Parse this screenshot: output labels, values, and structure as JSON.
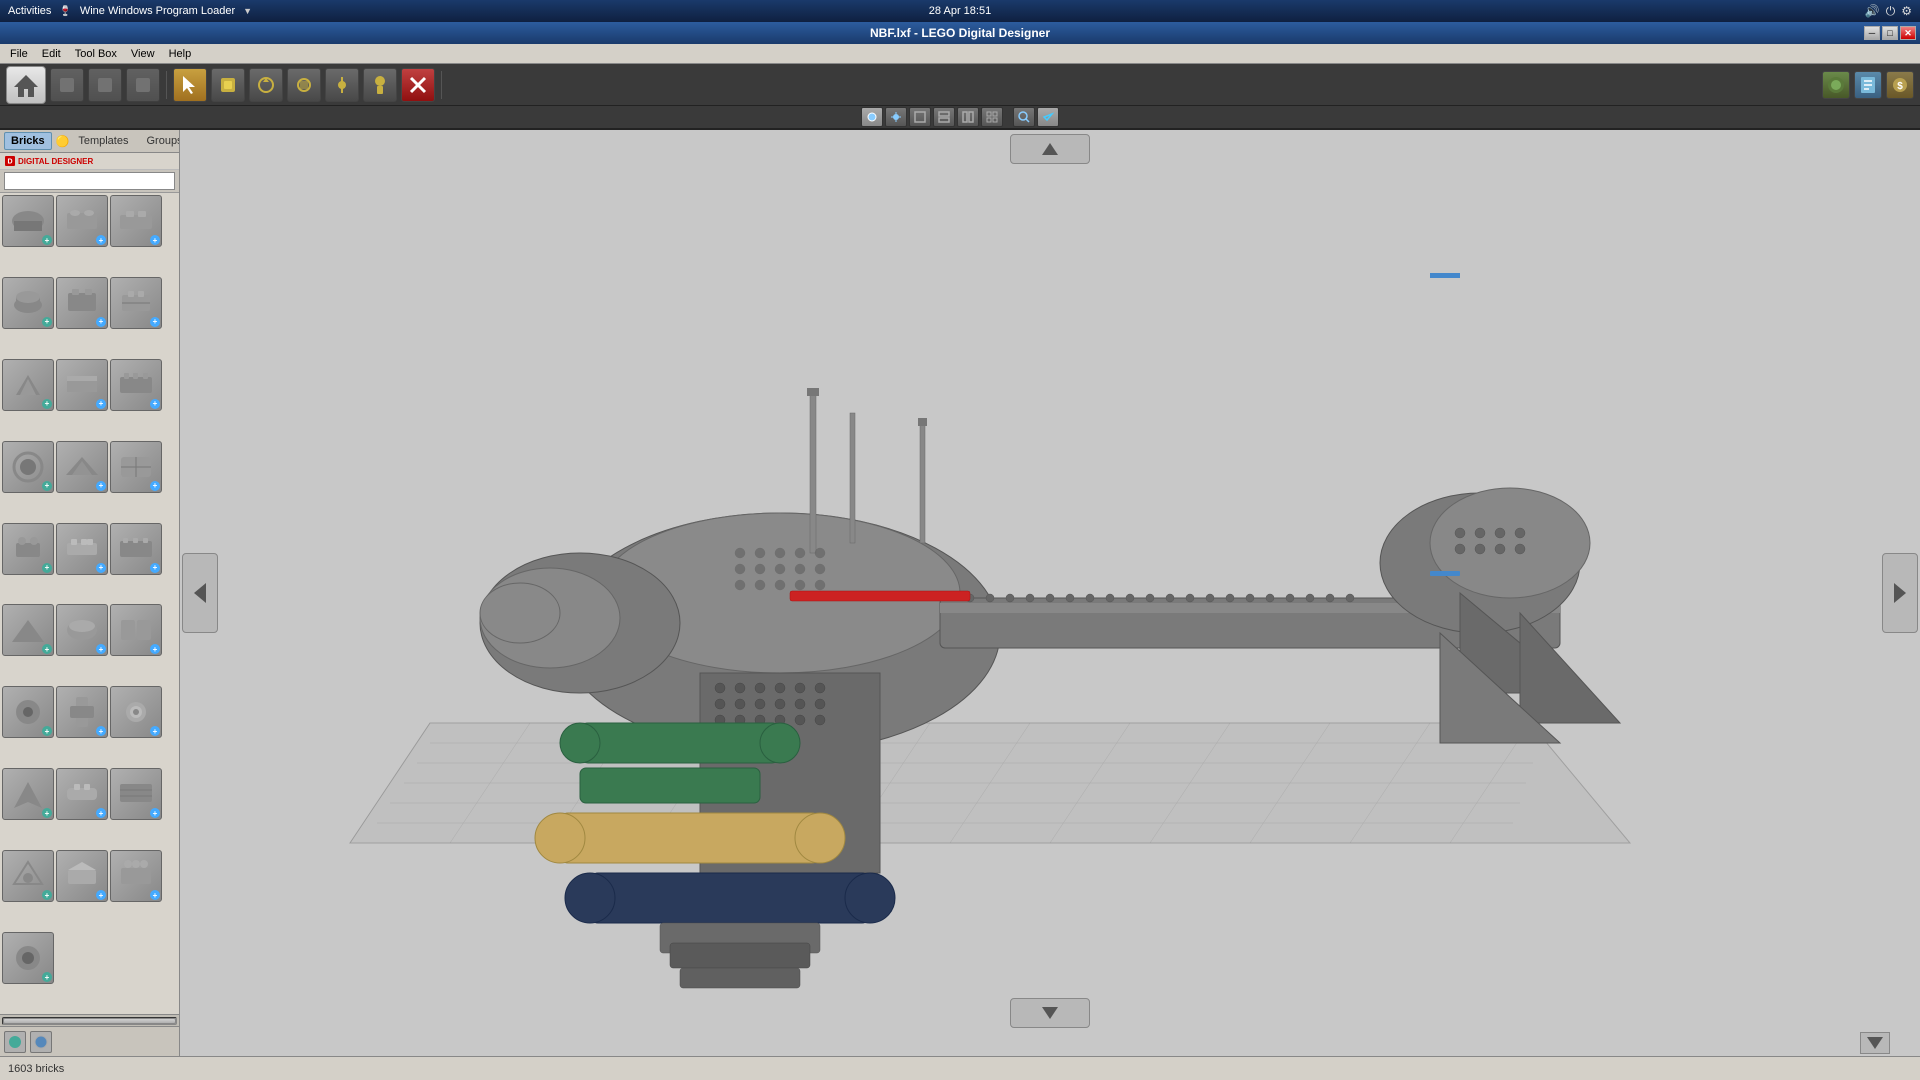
{
  "system": {
    "activities_label": "Activities",
    "wine_label": "Wine Windows Program Loader",
    "datetime": "28 Apr  18:51"
  },
  "window": {
    "title": "NBF.lxf - LEGO Digital Designer",
    "close_symbol": "✕",
    "minimize_symbol": "─",
    "maximize_symbol": "□"
  },
  "menu": {
    "items": [
      "File",
      "Edit",
      "Tool Box",
      "View",
      "Help"
    ]
  },
  "toolbar": {
    "home_icon": "🏠",
    "tools": [
      {
        "name": "select",
        "icon": "↖",
        "active": true
      },
      {
        "name": "move",
        "icon": "✋"
      },
      {
        "name": "rotate3d",
        "icon": "⟳"
      },
      {
        "name": "multirotate",
        "icon": "⟲"
      },
      {
        "name": "hinge",
        "icon": "🔧"
      },
      {
        "name": "paint",
        "icon": "🎨"
      },
      {
        "name": "delete",
        "icon": "✕",
        "accent": true
      }
    ]
  },
  "toolbar2": {
    "tools": [
      {
        "name": "snap",
        "icon": "◼",
        "active": true
      },
      {
        "name": "grid",
        "icon": "⊞"
      },
      {
        "name": "view1",
        "icon": "◱"
      },
      {
        "name": "view2",
        "icon": "◰"
      },
      {
        "name": "view3",
        "icon": "◳"
      },
      {
        "name": "view4",
        "icon": "◲"
      },
      {
        "name": "zoomin",
        "icon": "⊕",
        "active": true
      }
    ]
  },
  "panel": {
    "tabs": [
      {
        "label": "Bricks",
        "active": true
      },
      {
        "label": "Templates"
      },
      {
        "label": "Groups"
      }
    ],
    "search_placeholder": "",
    "logo_text": "DIGITAL DESIGNER",
    "brick_count": "1603 bricks"
  },
  "navigation": {
    "left_arrow": "◀",
    "right_arrow": "▶",
    "up_arrow": "▲",
    "down_arrow": "▼"
  },
  "statusbar": {
    "brick_count_label": "1603 bricks"
  }
}
